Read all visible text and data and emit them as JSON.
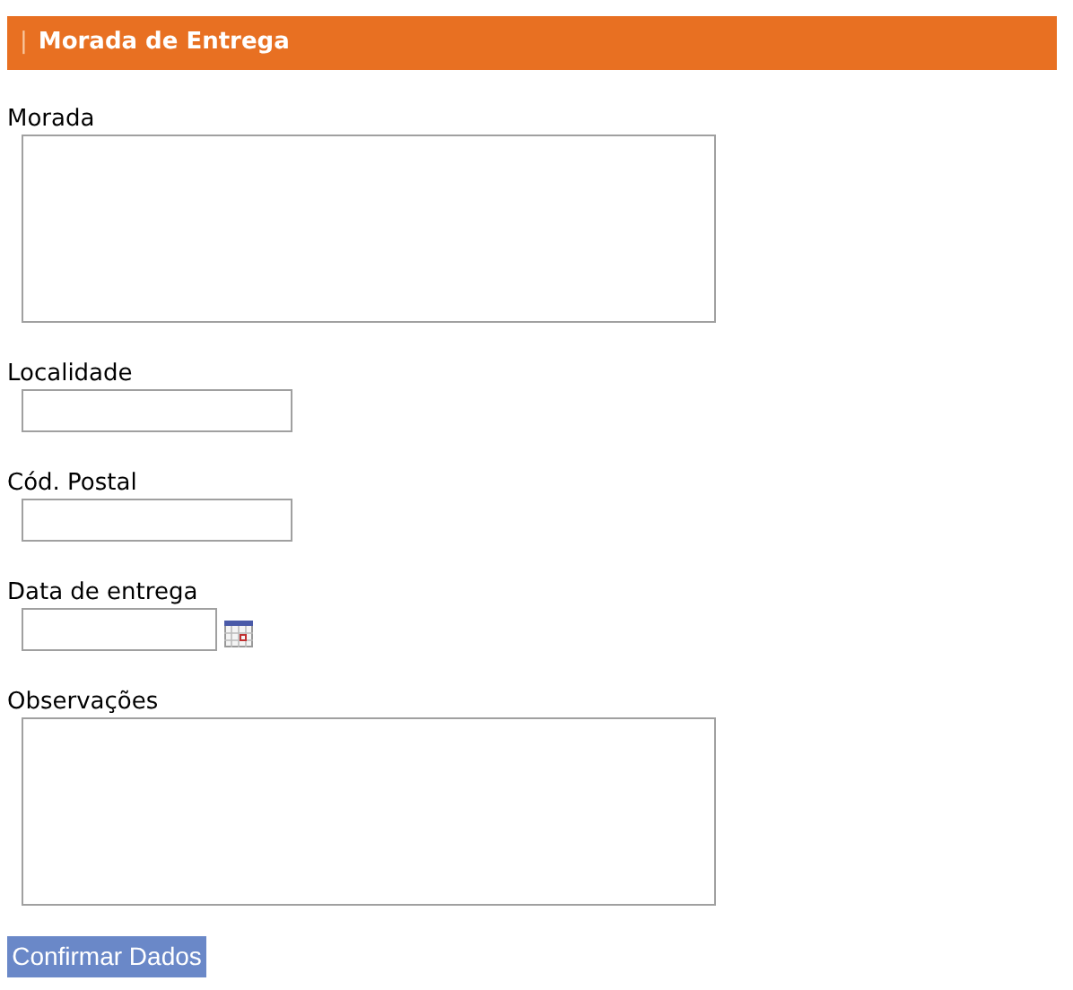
{
  "header": {
    "marker": "|",
    "title": "Morada de Entrega"
  },
  "fields": [
    {
      "label": "Morada",
      "kind": "textarea"
    },
    {
      "label": "Localidade",
      "kind": "text"
    },
    {
      "label": "Cód. Postal",
      "kind": "text"
    },
    {
      "label": "Data de entrega",
      "kind": "date"
    },
    {
      "label": "Observações",
      "kind": "textarea"
    }
  ],
  "submit": "Confirmar Dados"
}
